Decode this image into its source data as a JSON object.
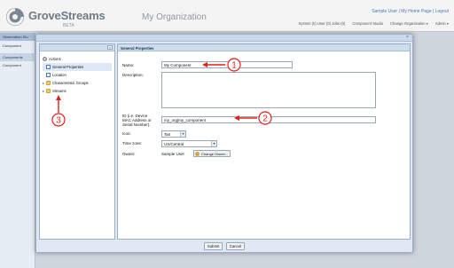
{
  "header": {
    "brand": "GroveStreams",
    "brand_sub": "BETA",
    "org_title": "My Organization",
    "user_links": "Sample User | My Home Page | Logout",
    "nav": [
      "System (0) User (0) Jobs (0)",
      "Component Studio",
      "Change Organization ▾",
      "Admin ▾"
    ]
  },
  "background": {
    "strip1": "Observation Stu",
    "item1": "Component",
    "strip2": "Components",
    "item2": "Component"
  },
  "tree": {
    "root": "Actions",
    "items": [
      {
        "label": "General Properties",
        "icon": "page-icon",
        "selected": true
      },
      {
        "label": "Location",
        "icon": "page-icon",
        "selected": false
      },
      {
        "label": "Characteristic Groups",
        "icon": "folder-icon",
        "selected": false
      },
      {
        "label": "Streams",
        "icon": "folder-icon",
        "selected": false
      }
    ]
  },
  "panel": {
    "title": "General Properties"
  },
  "form": {
    "name_label": "Name:",
    "name_value": "My Component",
    "description_label": "Description:",
    "description_value": "",
    "id_label_1": "ID (i.e. Device",
    "id_label_2": "MAC Address or",
    "id_label_3": "Serial Number):",
    "id_value": "my_org|my_component",
    "icon_label": "Icon:",
    "icon_value": "Tan",
    "timezone_label": "Time zone:",
    "timezone_value": "US/Central",
    "owner_label": "Owner:",
    "owner_value": "Sample User",
    "change_owner": "Change Owner..."
  },
  "buttons": {
    "submit": "Submit",
    "cancel": "Cancel"
  },
  "annotations": {
    "n1": "1",
    "n2": "2",
    "n3": "3",
    "color": "#e0201a"
  }
}
